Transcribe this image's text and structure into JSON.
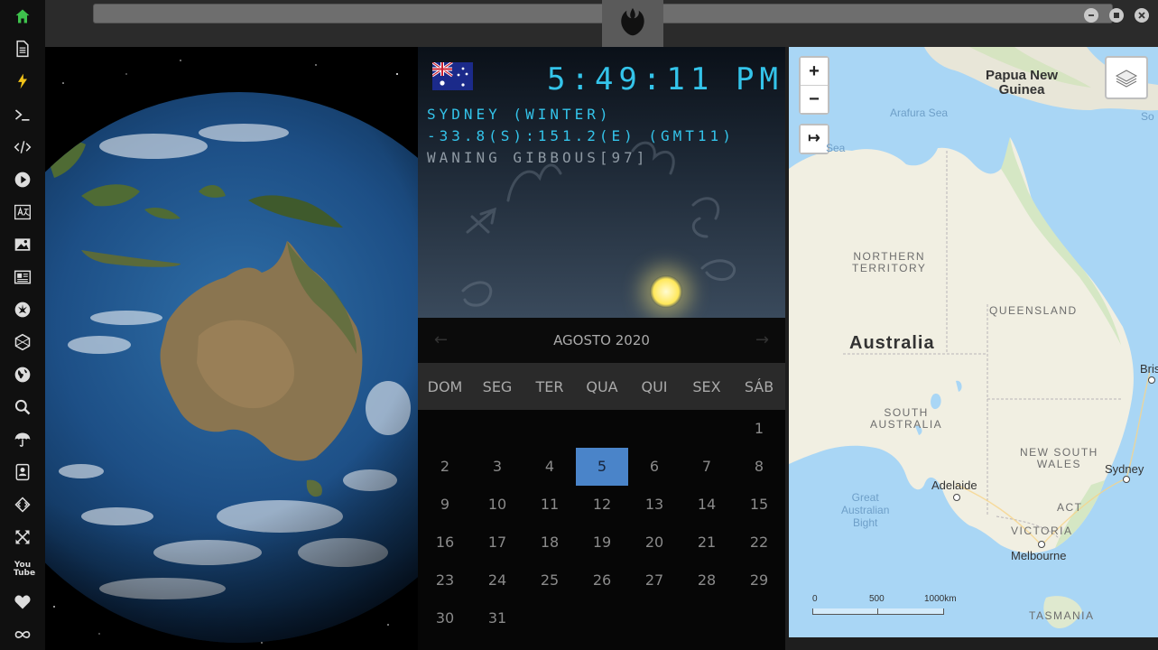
{
  "sidebar": {
    "icons": [
      "home-icon",
      "document-icon",
      "lightning-icon",
      "terminal-icon",
      "code-icon",
      "play-icon",
      "translate-icon",
      "image-icon",
      "news-icon",
      "rebel-alliance-icon",
      "hexagon-icon",
      "globe-icon",
      "search-icon",
      "umbrella-icon",
      "contacts-icon",
      "diamond-code-icon",
      "expand-icon",
      "youtube-icon",
      "heart-icon",
      "infinity-icon"
    ],
    "youtube_label": "You Tube"
  },
  "clock": {
    "time": "5:49:11",
    "ampm": "PM",
    "city_line": "SYDNEY (WINTER)",
    "coords_line": "-33.8(S):151.2(E) (GMT11)",
    "moon_line": "WANING GIBBOUS[97]"
  },
  "calendar": {
    "title": "AGOSTO 2020",
    "prev_arrow": "←",
    "next_arrow": "→",
    "days_of_week": [
      "DOM",
      "SEG",
      "TER",
      "QUA",
      "QUI",
      "SEX",
      "SÁB"
    ],
    "first_weekday": 6,
    "days": [
      "1",
      "2",
      "3",
      "4",
      "5",
      "6",
      "7",
      "8",
      "9",
      "10",
      "11",
      "12",
      "13",
      "14",
      "15",
      "16",
      "17",
      "18",
      "19",
      "20",
      "21",
      "22",
      "23",
      "24",
      "25",
      "26",
      "27",
      "28",
      "29",
      "30",
      "31"
    ],
    "selected_day": "5"
  },
  "map": {
    "zoom_in": "+",
    "zoom_out": "−",
    "arrow_btn": "↦",
    "labels": {
      "png": "Papua New\nGuinea",
      "arafura": "Arafura Sea",
      "so": "So",
      "sea": "Sea",
      "nt": "NORTHERN\nTERRITORY",
      "qld": "QUEENSLAND",
      "australia": "Australia",
      "sa": "SOUTH\nAUSTRALIA",
      "nsw": "NEW SOUTH\nWALES",
      "act": "ACT",
      "vic": "VICTORIA",
      "tas": "TASMANIA",
      "bight": "Great\nAustralian\nBight"
    },
    "cities": {
      "brisbane": "Brisb",
      "sydney": "Sydney",
      "adelaide": "Adelaide",
      "melbourne": "Melbourne"
    },
    "scale": {
      "s0": "0",
      "s500": "500",
      "s1000": "1000km"
    }
  },
  "colors": {
    "accent": "#4a84c9",
    "lcd": "#34c4ea",
    "home_icon": "#3ec24c"
  }
}
